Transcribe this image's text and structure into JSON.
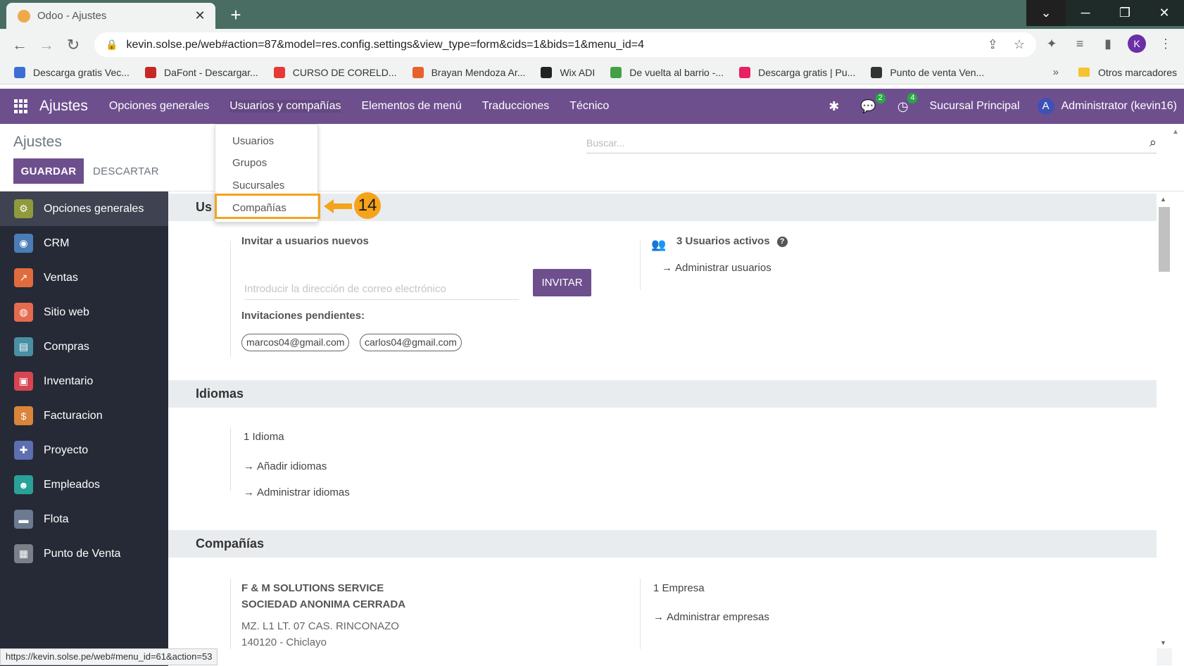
{
  "browser": {
    "tab_title": "Odoo - Ajustes",
    "tab_close": "✕",
    "new_tab": "+",
    "url": "kevin.solse.pe/web#action=87&model=res.config.settings&view_type=form&cids=1&bids=1&menu_id=4",
    "bookmarks": [
      {
        "label": "Descarga gratis Vec...",
        "color": "#3b6fd6"
      },
      {
        "label": "DaFont - Descargar...",
        "color": "#c62828"
      },
      {
        "label": "CURSO DE CORELD...",
        "color": "#e53935"
      },
      {
        "label": "Brayan Mendoza Ar...",
        "color": "#e8612c"
      },
      {
        "label": "Wix ADI",
        "color": "#222222"
      },
      {
        "label": "De vuelta al barrio -...",
        "color": "#43a047"
      },
      {
        "label": "Descarga gratis | Pu...",
        "color": "#e91e63"
      },
      {
        "label": "Punto de venta Ven...",
        "color": "#333333"
      }
    ],
    "bookmarks_more": "»",
    "other_bookmarks": "Otros marcadores",
    "profile_initial": "K",
    "status_url": "https://kevin.solse.pe/web#menu_id=61&action=53"
  },
  "navbar": {
    "brand": "Ajustes",
    "menus": [
      "Opciones generales",
      "Usuarios y compañías",
      "Elementos de menú",
      "Traducciones",
      "Técnico"
    ],
    "messages_count": "2",
    "activities_count": "4",
    "branch": "Sucursal Principal",
    "avatar_initial": "A",
    "user": "Administrator (kevin16)"
  },
  "control_panel": {
    "title": "Ajustes",
    "save_label": "GUARDAR",
    "discard_label": "DESCARTAR",
    "search_placeholder": "Buscar..."
  },
  "dropdown": {
    "items": [
      "Usuarios",
      "Grupos",
      "Sucursales",
      "Compañías"
    ],
    "callout_number": "14"
  },
  "sidebar": {
    "items": [
      {
        "label": "Opciones generales",
        "color": "#8e9a3c",
        "glyph": "⚙"
      },
      {
        "label": "CRM",
        "color": "#4a7db8",
        "glyph": "◉"
      },
      {
        "label": "Ventas",
        "color": "#e06c3d",
        "glyph": "↗"
      },
      {
        "label": "Sitio web",
        "color": "#e56b4f",
        "glyph": "◍"
      },
      {
        "label": "Compras",
        "color": "#4a90a4",
        "glyph": "▤"
      },
      {
        "label": "Inventario",
        "color": "#d64550",
        "glyph": "▣"
      },
      {
        "label": "Facturacion",
        "color": "#d9853b",
        "glyph": "$"
      },
      {
        "label": "Proyecto",
        "color": "#5c6fb0",
        "glyph": "✚"
      },
      {
        "label": "Empleados",
        "color": "#2aa198",
        "glyph": "☻"
      },
      {
        "label": "Flota",
        "color": "#6b7a8f",
        "glyph": "▬"
      },
      {
        "label": "Punto de Venta",
        "color": "#7a7f8a",
        "glyph": "▦"
      }
    ]
  },
  "users_section": {
    "header": "Us",
    "invite_label": "Invitar a usuarios nuevos",
    "email_placeholder": "Introducir la dirección de correo electrónico",
    "invite_button": "INVITAR",
    "pending_label": "Invitaciones pendientes:",
    "pending": [
      "marcos04@gmail.com",
      "carlos04@gmail.com"
    ],
    "active_users": "3 Usuarios activos",
    "help": "?",
    "manage_users": "Administrar usuarios"
  },
  "languages_section": {
    "header": "Idiomas",
    "count": "1 Idioma",
    "add": "Añadir idiomas",
    "manage": "Administrar idiomas"
  },
  "companies_section": {
    "header": "Compañías",
    "company_name_1": "F & M SOLUTIONS SERVICE",
    "company_name_2": "SOCIEDAD ANONIMA CERRADA",
    "address_1": "MZ. L1 LT. 07 CAS. RINCONAZO",
    "address_2": "140120 - Chiclayo",
    "count": "1 Empresa",
    "manage": "Administrar empresas"
  }
}
